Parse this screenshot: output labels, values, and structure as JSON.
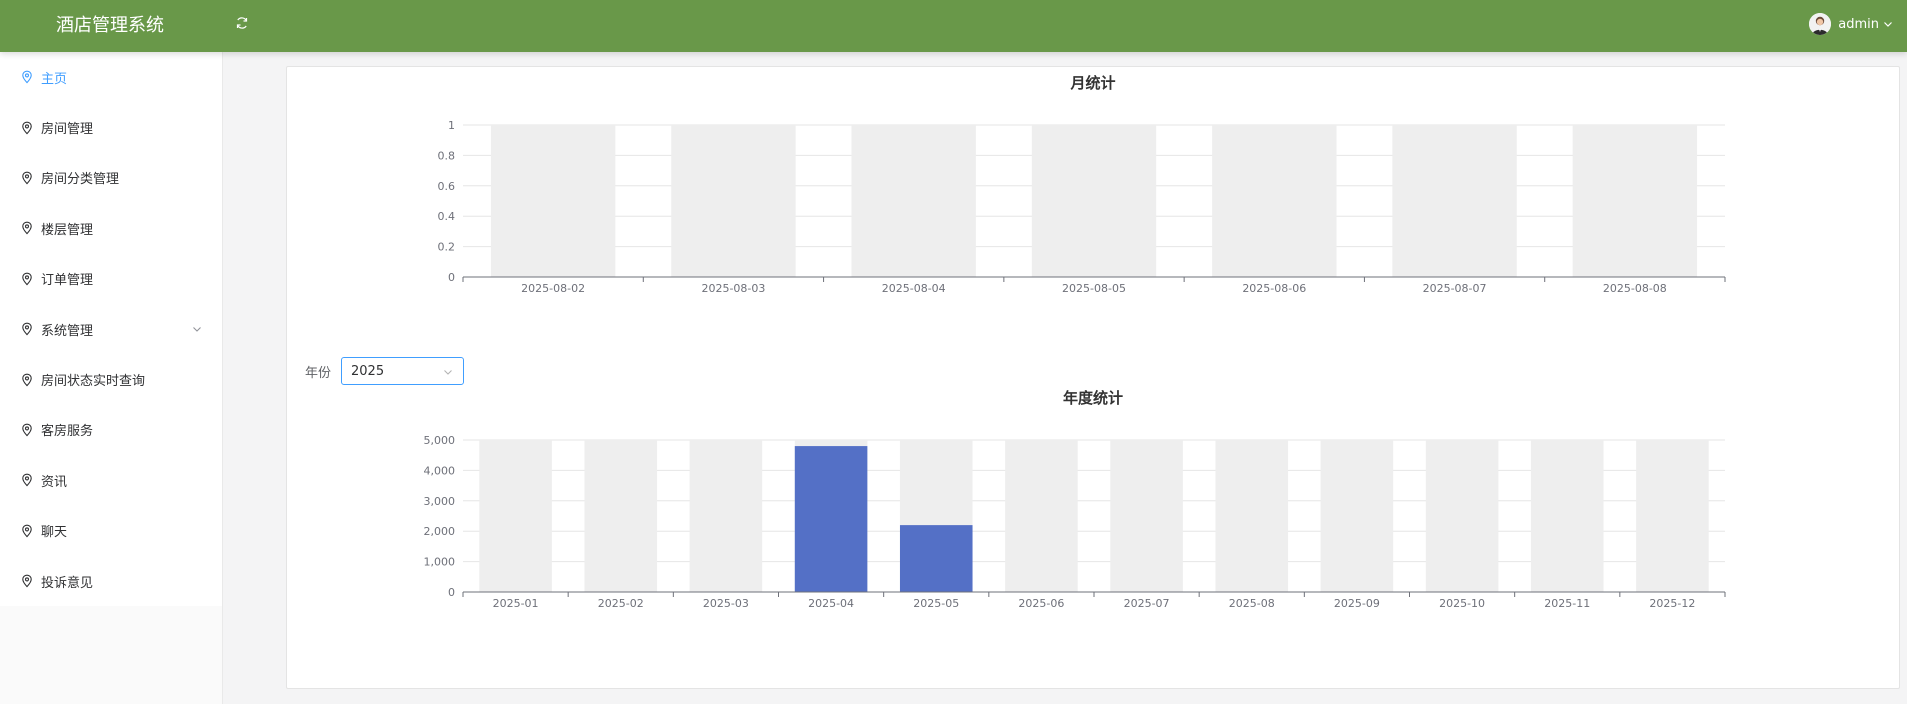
{
  "app": {
    "title": "酒店管理系统",
    "user": "admin"
  },
  "sidebar": {
    "items": [
      {
        "label": "主页",
        "active": true,
        "expandable": false
      },
      {
        "label": "房间管理",
        "active": false,
        "expandable": false
      },
      {
        "label": "房间分类管理",
        "active": false,
        "expandable": false
      },
      {
        "label": "楼层管理",
        "active": false,
        "expandable": false
      },
      {
        "label": "订单管理",
        "active": false,
        "expandable": false
      },
      {
        "label": "系统管理",
        "active": false,
        "expandable": true
      },
      {
        "label": "房间状态实时查询",
        "active": false,
        "expandable": false
      },
      {
        "label": "客房服务",
        "active": false,
        "expandable": false
      },
      {
        "label": "资讯",
        "active": false,
        "expandable": false
      },
      {
        "label": "聊天",
        "active": false,
        "expandable": false
      },
      {
        "label": "投诉意见",
        "active": false,
        "expandable": false
      }
    ]
  },
  "filter": {
    "year_label": "年份",
    "year_value": "2025"
  },
  "colors": {
    "header": "#699849",
    "active": "#409eff",
    "bar": "#5470c6",
    "bar_bg": "#eeeeee"
  },
  "chart_data": [
    {
      "type": "bar",
      "title": "月统计",
      "categories": [
        "2025-08-02",
        "2025-08-03",
        "2025-08-04",
        "2025-08-05",
        "2025-08-06",
        "2025-08-07",
        "2025-08-08"
      ],
      "values": [
        0,
        0,
        0,
        0,
        0,
        0,
        0
      ],
      "ylim": [
        0,
        1
      ],
      "yticks": [
        "0",
        "0.2",
        "0.4",
        "0.6",
        "0.8",
        "1"
      ],
      "grid": true
    },
    {
      "type": "bar",
      "title": "年度统计",
      "categories": [
        "2025-01",
        "2025-02",
        "2025-03",
        "2025-04",
        "2025-05",
        "2025-06",
        "2025-07",
        "2025-08",
        "2025-09",
        "2025-10",
        "2025-11",
        "2025-12"
      ],
      "values": [
        0,
        0,
        0,
        4800,
        2200,
        0,
        0,
        0,
        0,
        0,
        0,
        0
      ],
      "ylim": [
        0,
        5000
      ],
      "yticks": [
        "0",
        "1,000",
        "2,000",
        "3,000",
        "4,000",
        "5,000"
      ],
      "grid": true
    }
  ]
}
